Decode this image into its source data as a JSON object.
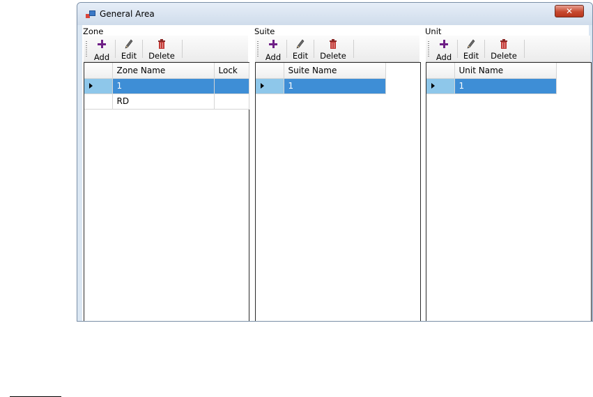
{
  "window": {
    "title": "General Area",
    "close_glyph": "✕"
  },
  "icons": {
    "app": "app-window-icon",
    "add": "plus-icon",
    "edit": "pencil-icon",
    "delete": "trash-icon",
    "row_current": "row-pointer-icon"
  },
  "colors": {
    "selection": "#3e8ed6",
    "selected_row_header": "#8ec7ea",
    "add_icon": "#6e1f86",
    "delete_icon": "#c23a36"
  },
  "panels": {
    "zone": {
      "caption": "Zone",
      "toolbar": {
        "add": "Add",
        "edit": "Edit",
        "delete": "Delete"
      },
      "columns": [
        "Zone Name",
        "Lock"
      ],
      "rows": [
        {
          "name": "1",
          "lock": ""
        },
        {
          "name": "RD",
          "lock": ""
        }
      ]
    },
    "suite": {
      "caption": "Suite",
      "toolbar": {
        "add": "Add",
        "edit": "Edit",
        "delete": "Delete"
      },
      "columns": [
        "Suite Name"
      ],
      "rows": [
        {
          "name": "1"
        }
      ]
    },
    "unit": {
      "caption": "Unit",
      "toolbar": {
        "add": "Add",
        "edit": "Edit",
        "delete": "Delete"
      },
      "columns": [
        "Unit Name"
      ],
      "rows": [
        {
          "name": "1"
        }
      ]
    }
  }
}
